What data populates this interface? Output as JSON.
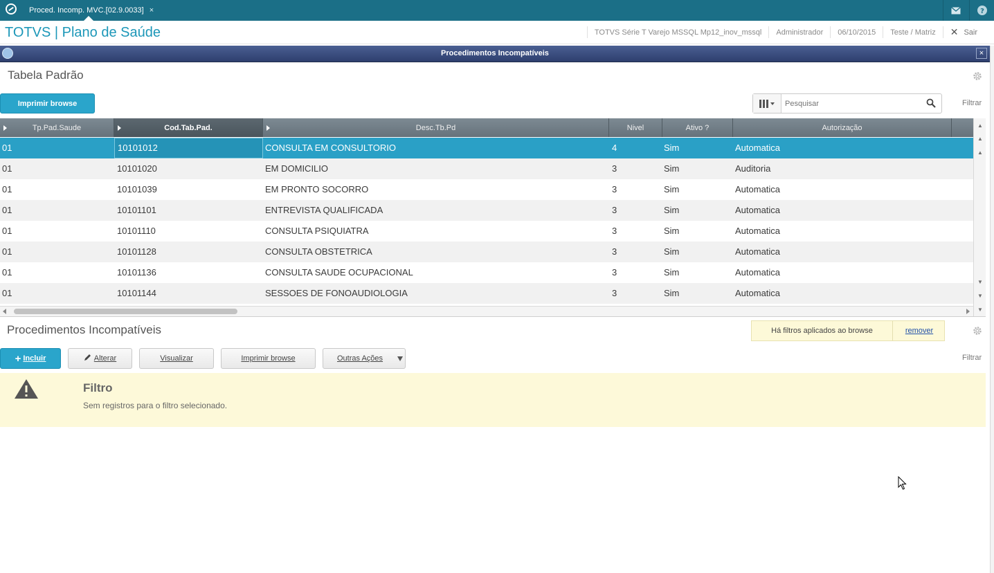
{
  "topbar": {
    "tab_label": "Proced. Incomp. MVC.[02.9.0033]",
    "tab_close": "×"
  },
  "header": {
    "app_title": "TOTVS | Plano de Saúde",
    "environment": "TOTVS Série T Varejo MSSQL Mp12_inov_mssql",
    "user": "Administrador",
    "date": "06/10/2015",
    "branch": "Teste / Matriz",
    "logout": "Sair"
  },
  "window": {
    "title": "Procedimentos Incompatíveis",
    "close": "×"
  },
  "upper": {
    "title": "Tabela Padrão",
    "print_button": "Imprimir browse",
    "search_placeholder": "Pesquisar",
    "filter_link": "Filtrar"
  },
  "grid": {
    "columns": [
      "Tp.Pad.Saude",
      "Cod.Tab.Pad.",
      "Desc.Tb.Pd",
      "Nivel",
      "Ativo ?",
      "Autorização"
    ],
    "rows": [
      [
        "01",
        "10101012",
        "CONSULTA EM CONSULTORIO",
        "4",
        "Sim",
        "Automatica"
      ],
      [
        "01",
        "10101020",
        "EM DOMICILIO",
        "3",
        "Sim",
        "Auditoria"
      ],
      [
        "01",
        "10101039",
        "EM PRONTO SOCORRO",
        "3",
        "Sim",
        "Automatica"
      ],
      [
        "01",
        "10101101",
        "ENTREVISTA QUALIFICADA",
        "3",
        "Sim",
        "Automatica"
      ],
      [
        "01",
        "10101110",
        "CONSULTA PSIQUIATRA",
        "3",
        "Sim",
        "Automatica"
      ],
      [
        "01",
        "10101128",
        "CONSULTA OBSTETRICA",
        "3",
        "Sim",
        "Automatica"
      ],
      [
        "01",
        "10101136",
        "CONSULTA SAUDE OCUPACIONAL",
        "3",
        "Sim",
        "Automatica"
      ],
      [
        "01",
        "10101144",
        "SESSOES DE FONOAUDIOLOGIA",
        "3",
        "Sim",
        "Automatica"
      ]
    ]
  },
  "lower": {
    "title": "Procedimentos Incompatíveis",
    "filter_note": "Há filtros aplicados ao browse",
    "remove_link": "remover",
    "buttons": {
      "incluir": "Incluir",
      "alterar": "Alterar",
      "visualizar": "Visualizar",
      "imprimir": "Imprimir browse",
      "outras": "Outras Ações"
    },
    "filter_link": "Filtrar",
    "alert_title": "Filtro",
    "alert_message": "Sem registros para o filtro selecionado."
  },
  "colors": {
    "topbar": "#1b6f87",
    "accent": "#2aa5cb",
    "selected_row": "#2aa0c6",
    "alert_bg": "#fdf9d9"
  }
}
